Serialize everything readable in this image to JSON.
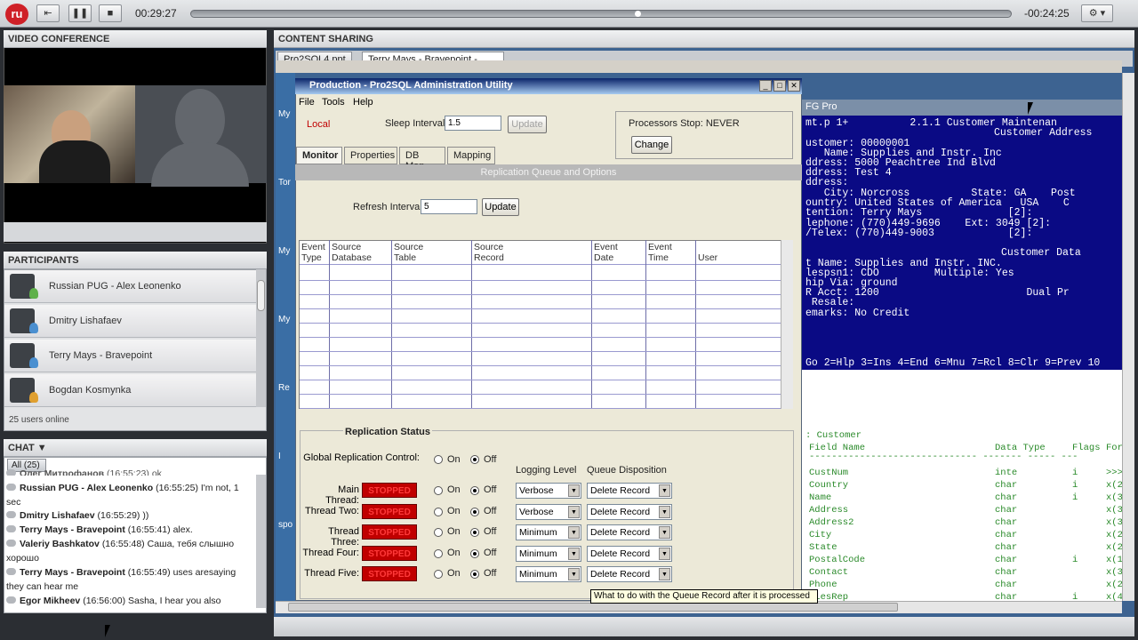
{
  "player": {
    "time_elapsed": "00:29:27",
    "time_remaining": "-00:24:25",
    "progress_fraction": 0.545
  },
  "video_conference": {
    "title": "VIDEO CONFERENCE"
  },
  "participants": {
    "title": "PARTICIPANTS",
    "users": [
      {
        "name": "Russian PUG - Alex Leonenko",
        "badge_color": "#5fb04a"
      },
      {
        "name": "Dmitry Lishafaev",
        "badge_color": "#4a8fd0"
      },
      {
        "name": "Terry Mays - Bravepoint",
        "badge_color": "#4a8fd0"
      },
      {
        "name": "Bogdan Kosmynka",
        "badge_color": "#e0a030"
      }
    ],
    "online_count": "25 users online"
  },
  "chat": {
    "title": "CHAT ▼",
    "filter_tab": "All (25)",
    "messages": [
      {
        "user": "Олег Митрофанов",
        "time": "(16:55:23)",
        "text": "ok"
      },
      {
        "user": "Russian PUG - Alex Leonenko",
        "time": "(16:55:25)",
        "text": "I'm not, 1 sec"
      },
      {
        "user": "Dmitry Lishafaev",
        "time": "(16:55:29)",
        "text": "))"
      },
      {
        "user": "Terry Mays - Bravepoint",
        "time": "(16:55:41)",
        "text": "alex."
      },
      {
        "user": "Valeriy Bashkatov",
        "time": "(16:55:48)",
        "text": "Саша, тебя слышно хорошо"
      },
      {
        "user": "Terry Mays - Bravepoint",
        "time": "(16:55:49)",
        "text": "uses aresaying they can hear me"
      },
      {
        "user": "Egor Mikheev",
        "time": "(16:56:00)",
        "text": "Sasha, I hear you also"
      }
    ]
  },
  "content_sharing": {
    "title": "CONTENT SHARING",
    "tabs": [
      "Pro2SQL4.ppt",
      "Terry Mays - Bravepoint -..."
    ],
    "strip_labels": [
      "My",
      "Tor",
      "My",
      "My",
      "Re",
      "I",
      "spo"
    ]
  },
  "app": {
    "title": "Production - Pro2SQL Administration Utility",
    "menu": [
      "File",
      "Tools",
      "Help"
    ],
    "local_label": "Local",
    "sleep_interval_label": "Sleep Interval:",
    "sleep_interval_value": "1.5",
    "update_label": "Update",
    "processors_stop": "Processors Stop: NEVER",
    "change_label": "Change",
    "tabs": [
      "Monitor",
      "Properties",
      "DB Map",
      "Mapping"
    ],
    "section_title": "Replication Queue and Options",
    "refresh_interval_label": "Refresh Interval:",
    "refresh_interval_value": "5",
    "grid_columns": [
      {
        "line1": "Event",
        "line2": "Type"
      },
      {
        "line1": "Source",
        "line2": "Database"
      },
      {
        "line1": "Source",
        "line2": "Table"
      },
      {
        "line1": "Source",
        "line2": "Record"
      },
      {
        "line1": "Event",
        "line2": "Date"
      },
      {
        "line1": "Event",
        "line2": "Time"
      },
      {
        "line1": "",
        "line2": "User"
      }
    ],
    "replication_status_title": "Replication Status",
    "global_label": "Global Replication Control:",
    "on_label": "On",
    "off_label": "Off",
    "logging_level_label": "Logging Level",
    "queue_disposition_label": "Queue Disposition",
    "stopped_label": "STOPPED",
    "threads": [
      {
        "name": "Main Thread:",
        "logging": "Verbose",
        "disposition": "Delete Record"
      },
      {
        "name": "Thread Two:",
        "logging": "Verbose",
        "disposition": "Delete Record"
      },
      {
        "name": "Thread Three:",
        "logging": "Minimum",
        "disposition": "Delete Record"
      },
      {
        "name": "Thread Four:",
        "logging": "Minimum",
        "disposition": "Delete Record"
      },
      {
        "name": "Thread Five:",
        "logging": "Minimum",
        "disposition": "Delete Record"
      }
    ],
    "tooltip": "What to do with the Queue Record after it is processed"
  },
  "terminal": {
    "title": "FG Pro",
    "header_line": "mt.p 1+          2.1.1 Customer Maintenan",
    "section1": "Customer Address",
    "lines1": [
      "ustomer: 00000001",
      "   Name: Supplies and Instr. Inc",
      "ddress: 5000 Peachtree Ind Blvd",
      "ddress: Test 4",
      "ddress:",
      "   City: Norcross          State: GA    Post",
      "ountry: United States of America   USA    C",
      "tention: Terry Mays              [2]:",
      "lephone: (770)449-9696    Ext: 3049 [2]:",
      "/Telex: (770)449-9003            [2]:"
    ],
    "section2": "Customer Data",
    "lines2": [
      "t Name: Supplies and Instr. INC.",
      "lespsn1: CDO         Multiple: Yes",
      "hip Via: ground",
      "R Acct: 1200                        Dual Pr",
      " Resale:",
      "emarks: No Credit"
    ],
    "fkeys": "Go 2=Hlp 3=Ins 4=End 6=Mnu 7=Rcl 8=Clr 9=Prev 10",
    "field_table_title": ": Customer",
    "field_headers": [
      "Field Name",
      "Data Type",
      "Flags",
      "For"
    ],
    "fields": [
      {
        "name": "CustNum",
        "type": "inte",
        "flag": "i",
        "fmt": ">>>"
      },
      {
        "name": "Country",
        "type": "char",
        "flag": "i",
        "fmt": "x(2"
      },
      {
        "name": "Name",
        "type": "char",
        "flag": "i",
        "fmt": "x(3"
      },
      {
        "name": "Address",
        "type": "char",
        "flag": "",
        "fmt": "x(3"
      },
      {
        "name": "Address2",
        "type": "char",
        "flag": "",
        "fmt": "x(3"
      },
      {
        "name": "City",
        "type": "char",
        "flag": "",
        "fmt": "x(2"
      },
      {
        "name": "State",
        "type": "char",
        "flag": "",
        "fmt": "x(2"
      },
      {
        "name": "PostalCode",
        "type": "char",
        "flag": "i",
        "fmt": "x(1"
      },
      {
        "name": "Contact",
        "type": "char",
        "flag": "",
        "fmt": "x(3"
      },
      {
        "name": "Phone",
        "type": "char",
        "flag": "",
        "fmt": "x(2"
      },
      {
        "name": "alesRep",
        "type": "char",
        "flag": "i",
        "fmt": "x(4"
      }
    ]
  }
}
